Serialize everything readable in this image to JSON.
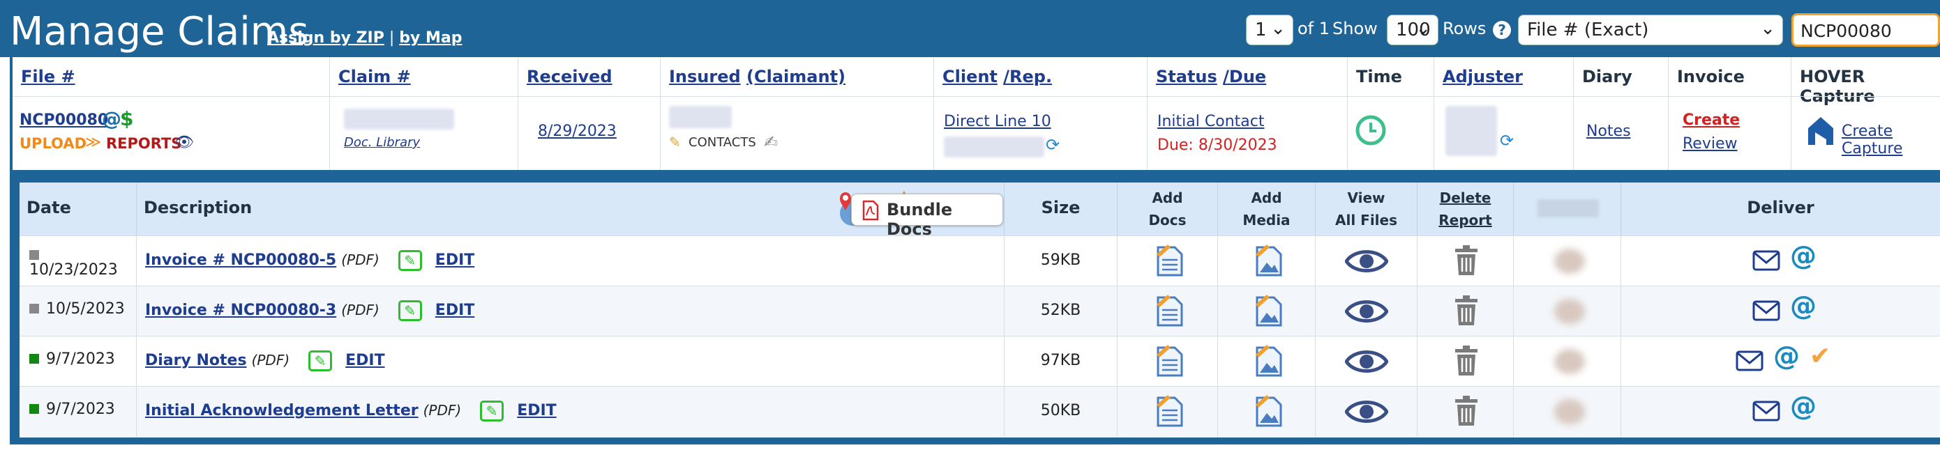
{
  "header": {
    "title": "Manage Claims",
    "assign_zip": "Assign by ZIP",
    "separator": "|",
    "by_map": "by Map",
    "page_select": "1",
    "of_pages": "of 1",
    "show_label": "Show",
    "rows_select": "100",
    "rows_label": "Rows",
    "help": "?",
    "search_mode": "File # (Exact)",
    "search_value": "NCP00080"
  },
  "claim_columns": {
    "file": "File #",
    "claim": "Claim #",
    "received": "Received",
    "insured": "Insured",
    "claimant": "(Claimant)",
    "client": "Client",
    "rep": "/Rep.",
    "status": "Status",
    "due": "/Due",
    "time": "Time",
    "adjuster": "Adjuster",
    "diary": "Diary",
    "invoice": "Invoice",
    "hover": "HOVER Capture"
  },
  "claim": {
    "file_no": "NCP00080",
    "upload": "UPLOAD",
    "reports": "REPORTS",
    "doc_library": "Doc. Library",
    "received": "8/29/2023",
    "contacts": "CONTACTS",
    "client": "Direct Line 10",
    "status": "Initial Contact",
    "due": "Due: 8/30/2023",
    "diary": "Notes",
    "invoice_create": "Create",
    "invoice_review": "Review",
    "hover_create": "Create Capture"
  },
  "docs_header": {
    "date": "Date",
    "description": "Description",
    "bundle": "Bundle Docs",
    "size": "Size",
    "add_docs_1": "Add",
    "add_docs_2": "Docs",
    "add_media_1": "Add",
    "add_media_2": "Media",
    "view_1": "View",
    "view_2": "All Files",
    "delete_1": "Delete",
    "delete_2": "Report",
    "deliver": "Deliver"
  },
  "documents": [
    {
      "date": "10/23/2023",
      "name": "Invoice # NCP00080-5",
      "type": "(PDF)",
      "edit": "EDIT",
      "size": "59KB",
      "status_color": "#888888",
      "delivered": false
    },
    {
      "date": "10/5/2023",
      "name": "Invoice # NCP00080-3",
      "type": "(PDF)",
      "edit": "EDIT",
      "size": "52KB",
      "status_color": "#888888",
      "delivered": false
    },
    {
      "date": "9/7/2023",
      "name": "Diary Notes",
      "type": "(PDF)",
      "edit": "EDIT",
      "size": "97KB",
      "status_color": "#118811",
      "delivered": true
    },
    {
      "date": "9/7/2023",
      "name": "Initial Acknowledgement Letter",
      "type": "(PDF)",
      "edit": "EDIT",
      "size": "50KB",
      "status_color": "#118811",
      "delivered": false
    }
  ]
}
